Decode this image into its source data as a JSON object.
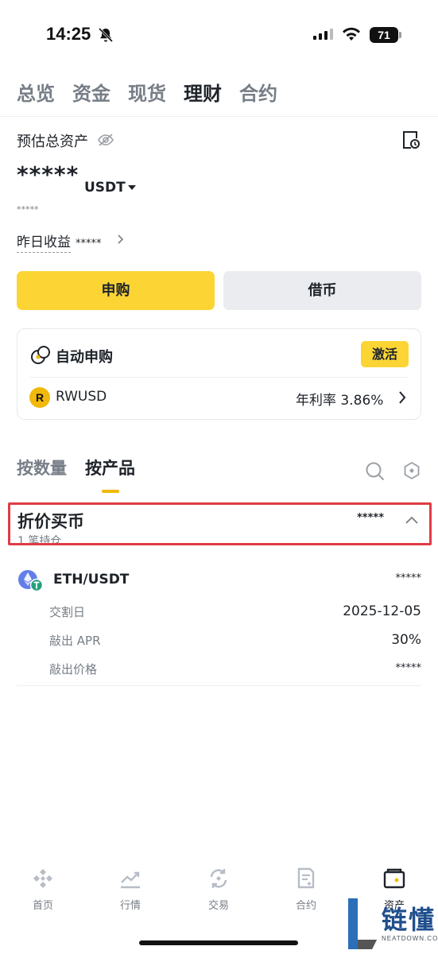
{
  "status_bar": {
    "time": "14:25",
    "battery": "71"
  },
  "top_tabs": [
    {
      "label": "总览",
      "active": false
    },
    {
      "label": "资金",
      "active": false
    },
    {
      "label": "现货",
      "active": false
    },
    {
      "label": "理财",
      "active": true
    },
    {
      "label": "合约",
      "active": false
    }
  ],
  "summary": {
    "label": "预估总资产",
    "value": "*****",
    "currency": "USDT",
    "sub_value": "*****",
    "yesterday_label": "昨日收益",
    "yesterday_value": "*****"
  },
  "actions": {
    "subscribe": "申购",
    "borrow": "借币"
  },
  "auto_card": {
    "title": "自动申购",
    "activate": "激活",
    "product_logo": "R",
    "product": "RWUSD",
    "apy": "年利率 3.86%"
  },
  "sub_tabs": {
    "by_amount": "按数量",
    "by_product": "按产品"
  },
  "group": {
    "title": "折价买币",
    "count": "1 笔持仓",
    "value": "*****"
  },
  "position": {
    "pair": "ETH/USDT",
    "value": "*****",
    "rows": [
      {
        "label": "交割日",
        "value": "2025-12-05"
      },
      {
        "label": "敲出 APR",
        "value": "30%"
      },
      {
        "label": "敲出价格",
        "value": "*****"
      }
    ]
  },
  "bottom_nav": [
    {
      "label": "首页",
      "icon": "home-diamond-icon"
    },
    {
      "label": "行情",
      "icon": "market-chart-icon"
    },
    {
      "label": "交易",
      "icon": "trade-swap-icon"
    },
    {
      "label": "合约",
      "icon": "futures-doc-icon"
    },
    {
      "label": "资产",
      "icon": "wallet-icon",
      "active": true
    }
  ],
  "watermark": {
    "text": "链懂",
    "sub": "NEATDOWN.COM"
  },
  "colors": {
    "accent": "#fcd535",
    "highlight_border": "#e03c45",
    "text_primary": "#1e2329",
    "text_secondary": "#777e87"
  }
}
